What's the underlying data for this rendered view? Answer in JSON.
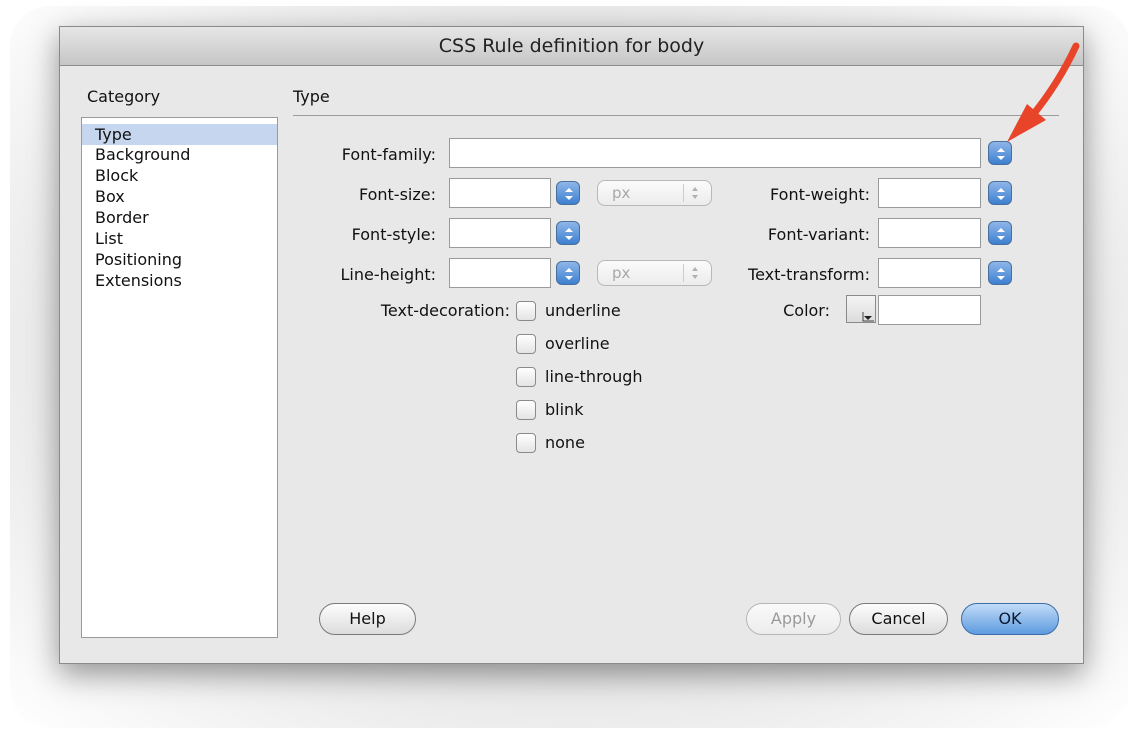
{
  "dialog": {
    "title": "CSS Rule definition for body"
  },
  "category": {
    "label": "Category",
    "items": [
      "Type",
      "Background",
      "Block",
      "Box",
      "Border",
      "List",
      "Positioning",
      "Extensions"
    ],
    "selected": "Type"
  },
  "section": {
    "title": "Type"
  },
  "fields": {
    "font_family": {
      "label": "Font-family:",
      "value": ""
    },
    "font_size": {
      "label": "Font-size:",
      "value": "",
      "unit": "px"
    },
    "font_weight": {
      "label": "Font-weight:",
      "value": ""
    },
    "font_style": {
      "label": "Font-style:",
      "value": ""
    },
    "font_variant": {
      "label": "Font-variant:",
      "value": ""
    },
    "line_height": {
      "label": "Line-height:",
      "value": "",
      "unit": "px"
    },
    "text_transform": {
      "label": "Text-transform:",
      "value": ""
    },
    "color": {
      "label": "Color:",
      "value": ""
    }
  },
  "text_decoration": {
    "label": "Text-decoration:",
    "options": [
      {
        "label": "underline",
        "checked": false
      },
      {
        "label": "overline",
        "checked": false
      },
      {
        "label": "line-through",
        "checked": false
      },
      {
        "label": "blink",
        "checked": false
      },
      {
        "label": "none",
        "checked": false
      }
    ]
  },
  "buttons": {
    "help": "Help",
    "apply": "Apply",
    "cancel": "Cancel",
    "ok": "OK"
  },
  "colors": {
    "selection": "#c5d6ee",
    "stepper_blue": "#3d7fd1",
    "annotation_arrow": "#e8442a"
  }
}
